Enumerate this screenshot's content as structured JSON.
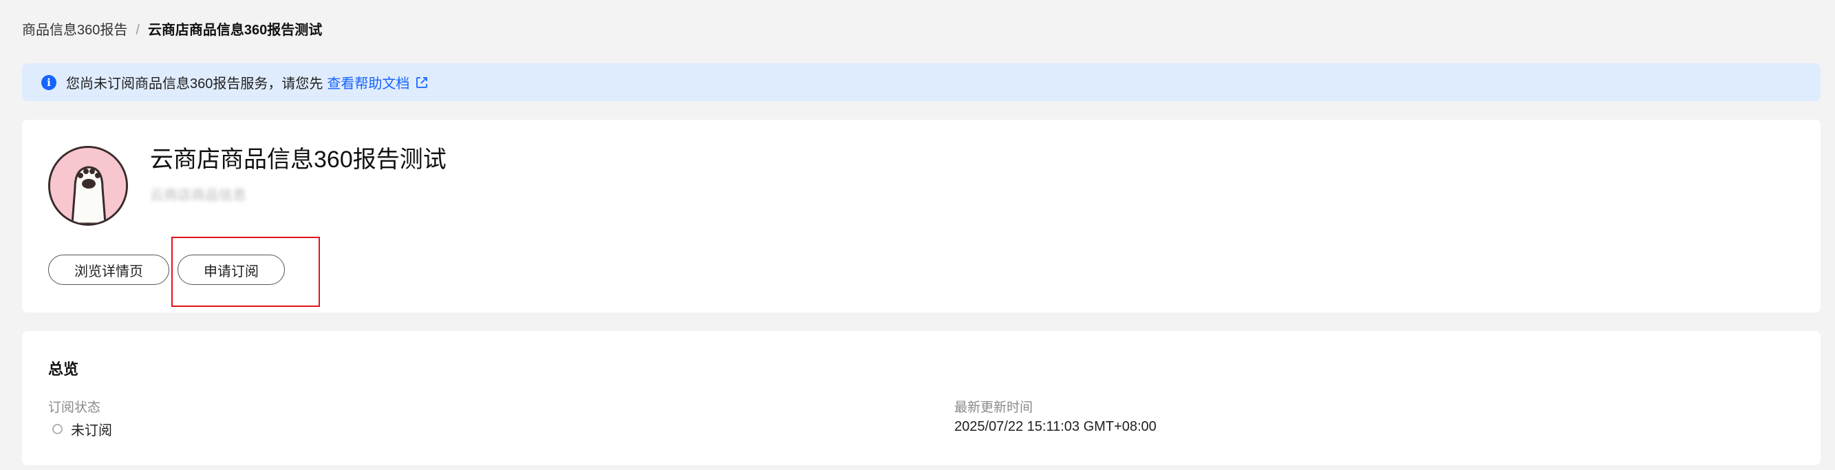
{
  "breadcrumb": {
    "parent": "商品信息360报告",
    "separator": "/",
    "current": "云商店商品信息360报告测试"
  },
  "notice": {
    "icon": "info-icon",
    "text": "您尚未订阅商品信息360报告服务，请您先",
    "link_text": "查看帮助文档",
    "link_icon": "external-link-icon",
    "color": "#1664ff"
  },
  "product": {
    "title": "云商店商品信息360报告测试",
    "subtitle": "云商店商品信息",
    "avatar_icon": "paw-avatar-icon",
    "buttons": {
      "browse": "浏览详情页",
      "subscribe": "申请订阅"
    }
  },
  "overview": {
    "title": "总览",
    "subscription_status_label": "订阅状态",
    "subscription_status_value": "未订阅",
    "last_update_label": "最新更新时间",
    "last_update_value": "2025/07/22 15:11:03 GMT+08:00"
  }
}
